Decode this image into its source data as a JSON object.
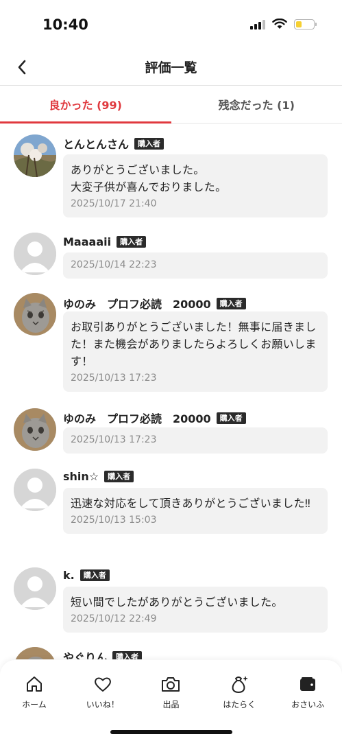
{
  "status_bar": {
    "time": "10:40",
    "battery_level": 0.35
  },
  "header": {
    "title": "評価一覧",
    "back_icon": "chevron-left-icon"
  },
  "tabs": [
    {
      "label": "良かった (99)",
      "active": true
    },
    {
      "label": "残念だった (1)",
      "active": false
    }
  ],
  "reviews": [
    {
      "name": "とんとんさん",
      "badge": "購入者",
      "comment": "ありがとうございました。\n大変子供が喜んでおりました。",
      "date": "2025/10/17 21:40",
      "avatar": "photo-landscape"
    },
    {
      "name": "Maaaaii",
      "badge": "購入者",
      "comment": "",
      "date": "2025/10/14 22:23",
      "avatar": "default"
    },
    {
      "name": "ゆのみ　プロフ必読　20000",
      "badge": "購入者",
      "comment": "お取引ありがとうございました！無事に届きました！また機会がありましたらよろしくお願いします！",
      "date": "2025/10/13 17:23",
      "avatar": "photo-cat"
    },
    {
      "name": "ゆのみ　プロフ必読　20000",
      "badge": "購入者",
      "comment": "",
      "date": "2025/10/13 17:23",
      "avatar": "photo-cat"
    },
    {
      "name": "shin☆",
      "badge": "購入者",
      "comment": "迅速な対応をして頂きありがとうございました‼",
      "date": "2025/10/13 15:03",
      "avatar": "default"
    },
    {
      "name": "k.",
      "badge": "購入者",
      "comment": "短い間でしたがありがとうございました。",
      "date": "2025/10/12 22:49",
      "avatar": "default"
    },
    {
      "name": "やぐりん",
      "badge": "購入者",
      "comment": "",
      "date": "",
      "avatar": "photo-cat"
    }
  ],
  "tab_bar": [
    {
      "label": "ホーム",
      "icon": "home-icon"
    },
    {
      "label": "いいね！",
      "icon": "heart-icon"
    },
    {
      "label": "出品",
      "icon": "camera-icon"
    },
    {
      "label": "はたらく",
      "icon": "money-bag-icon"
    },
    {
      "label": "おさいふ",
      "icon": "wallet-icon"
    }
  ],
  "colors": {
    "accent": "#e0393e",
    "badge_bg": "#2b2b2b",
    "bubble_bg": "#f2f2f2",
    "date_text": "#8a8a8a"
  }
}
